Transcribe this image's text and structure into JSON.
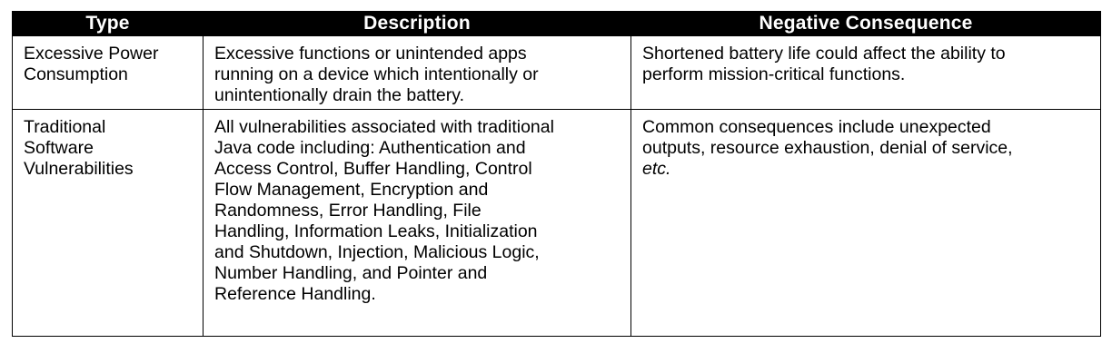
{
  "table": {
    "headers": [
      "Type",
      "Description",
      "Negative Consequence"
    ],
    "rows": [
      {
        "type_lines": [
          "Excessive Power",
          "Consumption"
        ],
        "description_lines": [
          "Excessive functions or unintended apps",
          "running on a device which intentionally or",
          "unintentionally drain the battery."
        ],
        "consequence_lines": [
          "Shortened battery life could affect the ability to",
          "perform mission-critical functions."
        ]
      },
      {
        "type_lines": [
          "Traditional",
          "Software",
          "Vulnerabilities"
        ],
        "description_lines": [
          "All vulnerabilities associated with traditional",
          "Java code including: Authentication and",
          "Access Control, Buffer Handling, Control",
          "Flow Management, Encryption and",
          "Randomness, Error Handling, File",
          "Handling, Information Leaks, Initialization",
          "and Shutdown, Injection, Malicious Logic,",
          "Number Handling, and Pointer and",
          "Reference Handling."
        ],
        "consequence_lines": [
          "Common consequences include unexpected",
          "outputs, resource exhaustion, denial of service,"
        ],
        "consequence_italic": "etc."
      }
    ]
  }
}
